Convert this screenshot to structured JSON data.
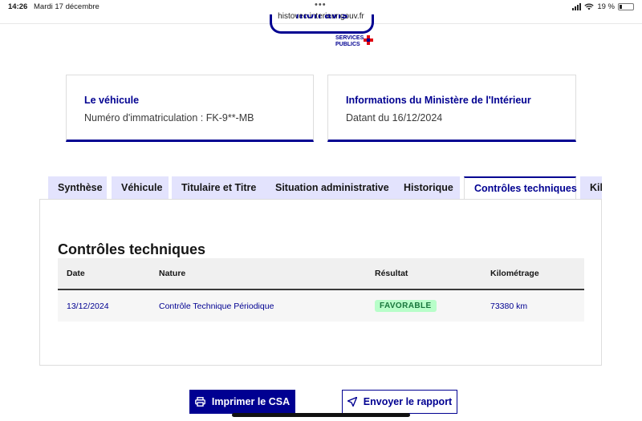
{
  "statusbar": {
    "time": "14:26",
    "date": "Mardi 17 décembre",
    "url": "histovec.interieur.gouv.fr",
    "battery": "19 %"
  },
  "header": {
    "mon_avis": "mon avis",
    "logo_line1": "SERVICES",
    "logo_line2": "PUBLICS",
    "logo_plus": "+"
  },
  "cards": {
    "vehicle": {
      "title": "Le véhicule",
      "text": "Numéro d'immatriculation : FK-9**-MB"
    },
    "ministry": {
      "title": "Informations du Ministère de l'Intérieur",
      "text": "Datant du 16/12/2024"
    }
  },
  "tabs": [
    {
      "label": "Synthèse"
    },
    {
      "label": "Véhicule"
    },
    {
      "label": "Titulaire et Titre"
    },
    {
      "label": "Situation administrative"
    },
    {
      "label": "Historique"
    },
    {
      "label": "Contrôles techniques"
    },
    {
      "label": "Kilométrage"
    }
  ],
  "active_tab": "Contrôles techniques",
  "section": {
    "title": "Contrôles techniques",
    "columns": [
      "Date",
      "Nature",
      "Résultat",
      "Kilométrage"
    ],
    "rows": [
      {
        "date": "13/12/2024",
        "nature": "Contrôle Technique Périodique",
        "result": "FAVORABLE",
        "mileage": "73380 km"
      }
    ]
  },
  "actions": {
    "print_label": "Imprimer le CSA",
    "send_label": "Envoyer le rapport"
  },
  "colors": {
    "primary": "#000091",
    "tab_inactive": "#e3e3fd",
    "badge_bg": "#b8fec9",
    "badge_text": "#18753c"
  }
}
